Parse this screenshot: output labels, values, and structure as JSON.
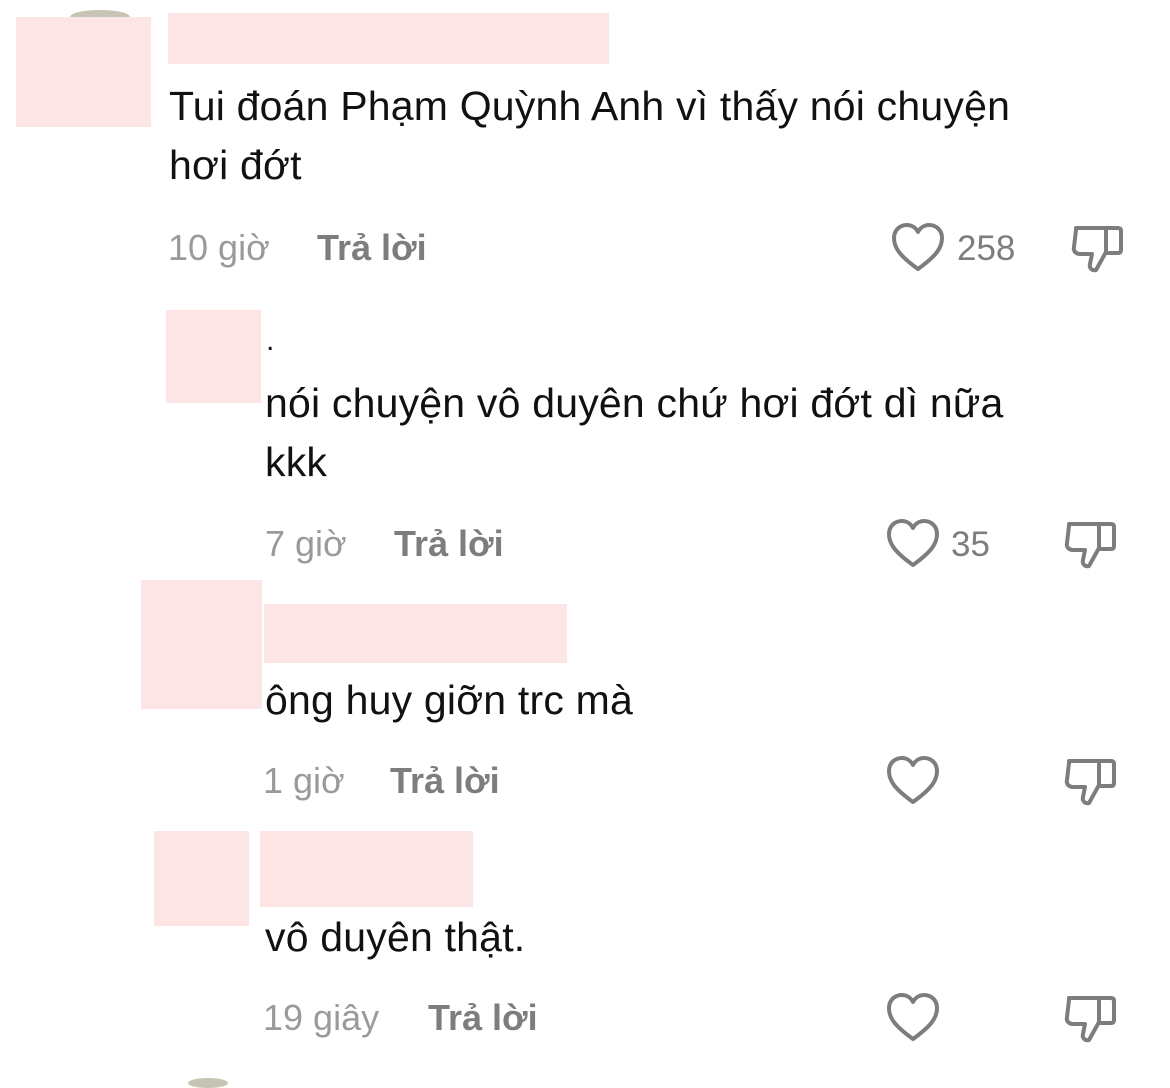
{
  "comments": [
    {
      "text_line1": "Tui đoán Phạm Quỳnh Anh vì thấy nói chuyện",
      "text_line2": "hơi đớt",
      "time": "10 giờ",
      "reply_label": "Trả lời",
      "likes": "258",
      "like_icon": "heart-outline-icon",
      "dislike_icon": "thumbs-down-icon"
    },
    {
      "username": ".",
      "text_line1": "nói chuyện vô duyên chứ hơi đớt dì nữa",
      "text_line2": "kkk",
      "time": "7 giờ",
      "reply_label": "Trả lời",
      "likes": "35",
      "like_icon": "heart-outline-icon",
      "dislike_icon": "thumbs-down-icon"
    },
    {
      "text_line1": "ông huy giỡn trc mà",
      "time": "1 giờ",
      "reply_label": "Trả lời",
      "likes": "",
      "like_icon": "heart-outline-icon",
      "dislike_icon": "thumbs-down-icon"
    },
    {
      "text_line1": "vô duyên thật.",
      "time": "19 giây",
      "reply_label": "Trả lời",
      "likes": "",
      "like_icon": "heart-outline-icon",
      "dislike_icon": "thumbs-down-icon"
    }
  ],
  "colors": {
    "redaction": "#fde4e5",
    "text": "#111111",
    "muted": "#9a9a9a"
  }
}
